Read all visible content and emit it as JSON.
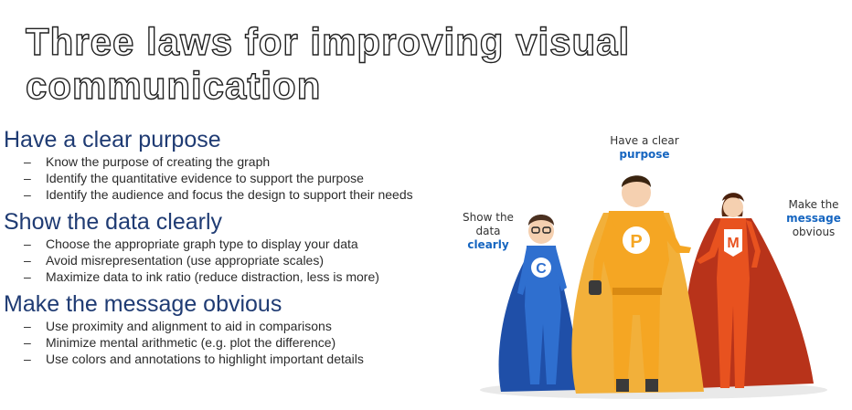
{
  "title": {
    "line1": "Three laws for improving visual",
    "line2": "communication"
  },
  "laws": [
    {
      "heading": "Have a clear purpose",
      "bullets": [
        "Know the purpose of creating the graph",
        "Identify the quantitative evidence to support the purpose",
        "Identify the audience and focus the design to support their needs"
      ]
    },
    {
      "heading": "Show the data clearly",
      "bullets": [
        "Choose the appropriate graph type to display your data",
        "Avoid misrepresentation (use appropriate scales)",
        "Maximize data to ink ratio (reduce distraction, less is more)"
      ]
    },
    {
      "heading": "Make the message obvious",
      "bullets": [
        "Use proximity and alignment to aid in comparisons",
        "Minimize mental arithmetic (e.g. plot the difference)",
        "Use colors and annotations to highlight important details"
      ]
    }
  ],
  "illustration": {
    "callout_purpose": {
      "line1": "Have a clear",
      "emphasis": "purpose"
    },
    "callout_clearly": {
      "line1": "Show the",
      "line2": "data",
      "emphasis": "clearly"
    },
    "callout_message": {
      "line1": "Make the",
      "emphasis": "message",
      "line3": "obvious"
    },
    "letters": {
      "c": "C",
      "p": "P",
      "m": "M"
    },
    "colors": {
      "blue": "#2f6fcf",
      "orange": "#f5a623",
      "red": "#e8521f",
      "cape_dark": "#b8331a"
    }
  }
}
